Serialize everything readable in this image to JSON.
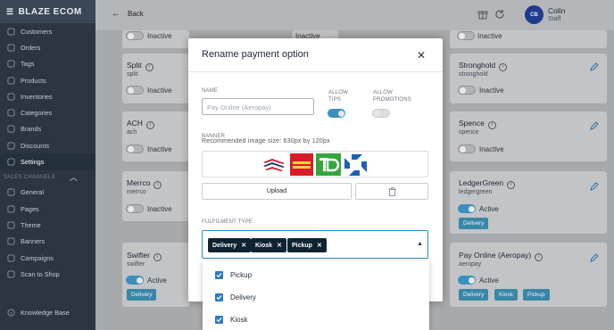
{
  "brand": {
    "name": "BLAZE ECOM"
  },
  "sidebar": {
    "items": [
      {
        "label": "Customers",
        "icon": "users-icon"
      },
      {
        "label": "Orders",
        "icon": "cart-icon"
      },
      {
        "label": "Tags",
        "icon": "tag-icon"
      },
      {
        "label": "Products",
        "icon": "box-icon"
      },
      {
        "label": "Inventories",
        "icon": "inventory-icon"
      },
      {
        "label": "Categories",
        "icon": "category-icon"
      },
      {
        "label": "Brands",
        "icon": "brand-icon"
      },
      {
        "label": "Discounts",
        "icon": "discount-icon"
      },
      {
        "label": "Settings",
        "icon": "gear-icon"
      }
    ],
    "section_label": "SALES CHANNELS",
    "channel_items": [
      {
        "label": "General",
        "icon": "store-icon"
      },
      {
        "label": "Pages",
        "icon": "page-icon"
      },
      {
        "label": "Theme",
        "icon": "theme-icon"
      },
      {
        "label": "Banners",
        "icon": "banner-icon"
      },
      {
        "label": "Campaigns",
        "icon": "bell-icon"
      },
      {
        "label": "Scan to Shop",
        "icon": "qr-icon"
      }
    ],
    "knowledge_base": "Knowledge Base"
  },
  "topbar": {
    "back_label": "Back",
    "user_initials": "CB",
    "user_name": "Colin",
    "user_role": "Staff"
  },
  "cards": {
    "inactive_label": "Inactive",
    "active_label": "Active",
    "split": {
      "name": "Split",
      "key": "split"
    },
    "ach": {
      "name": "ACH",
      "key": "ach"
    },
    "merrco": {
      "name": "Merrco",
      "key": "merrco"
    },
    "swifter": {
      "name": "Swifter",
      "key": "swifter",
      "badges": [
        "Delivery"
      ]
    },
    "stronghold": {
      "name": "Stronghold",
      "key": "stronghold"
    },
    "spence": {
      "name": "Spence",
      "key": "spence"
    },
    "ledgergreen": {
      "name": "LedgerGreen",
      "key": "ledgergreen",
      "badges": [
        "Delivery"
      ]
    },
    "aeropay": {
      "name": "Pay Online (Aeropay)",
      "key": "aeropay",
      "badges": [
        "Delivery",
        "Kiosk",
        "Pickup"
      ]
    }
  },
  "modal": {
    "title": "Rename payment option",
    "name_label": "NAME",
    "name_placeholder": "Pay Online (Aeropay)",
    "allow_tips_label": "ALLOW TIPS",
    "allow_tips": true,
    "allow_promotions_label": "ALLOW PROMOTIONS",
    "allow_promotions": false,
    "banner_label": "BANNER",
    "banner_hint": "Recommended image size: 630px by 120px",
    "bank_logos": [
      "bank-of-america-logo",
      "wells-fargo-logo",
      "td-logo",
      "chase-logo"
    ],
    "upload_label": "Upload",
    "fulfilment_label": "FULFILMENT TYPE",
    "selected_types": [
      "Delivery",
      "Kiosk",
      "Pickup"
    ],
    "options": [
      "Pickup",
      "Delivery",
      "Kiosk"
    ]
  },
  "colors": {
    "accent": "#2b77c9",
    "chip": "#0f2430",
    "sidebar": "#2b3640"
  }
}
